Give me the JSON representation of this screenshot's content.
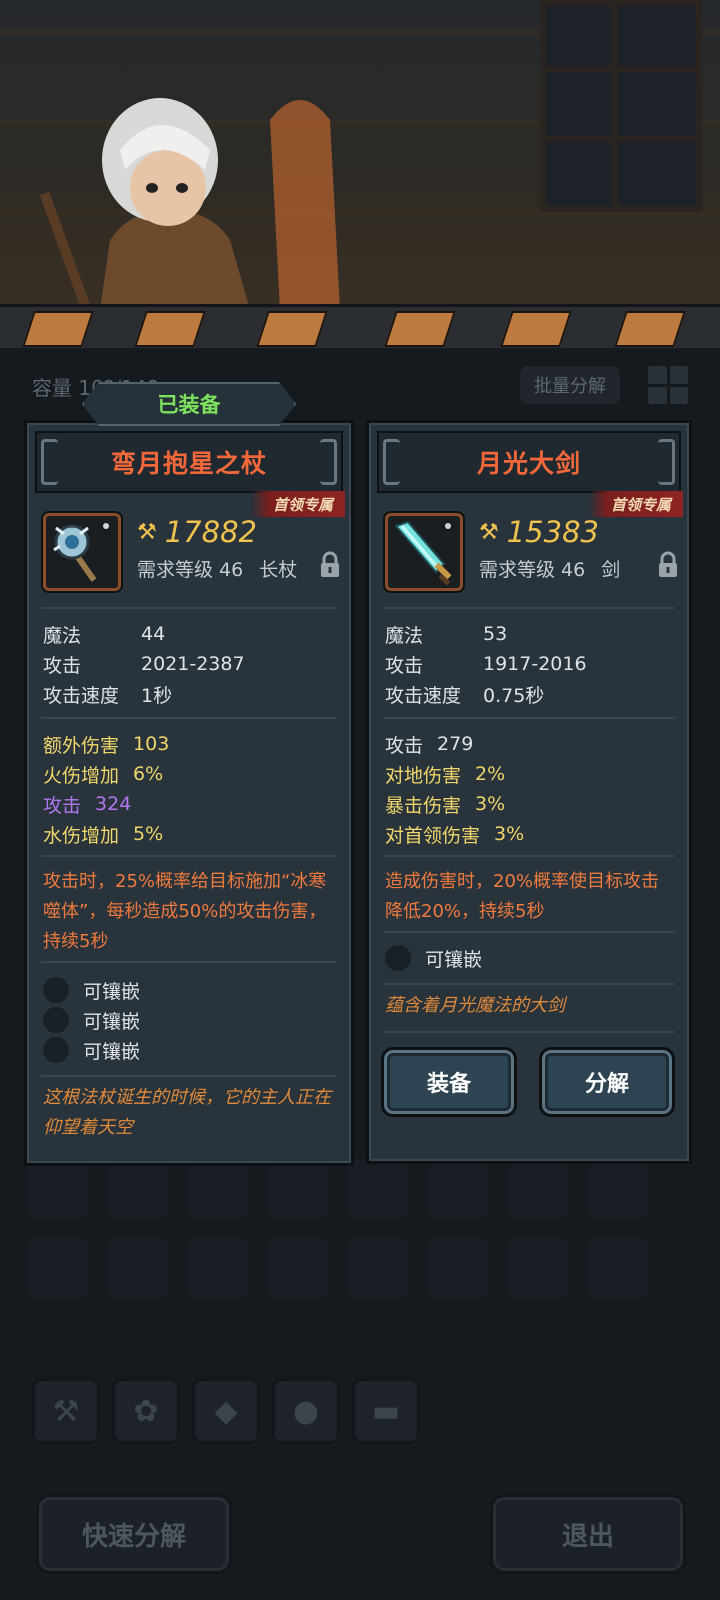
{
  "background": {
    "capacity_label": "容量 10?/140",
    "batch_button": "批量分解",
    "tabs": [
      "hammer-icon",
      "paw-icon",
      "gem-icon",
      "blob-icon",
      "chest-icon"
    ],
    "quick_decompose": "快速分解",
    "exit": "退出"
  },
  "equipped_label": "已装备",
  "left_card": {
    "title": "弯月抱星之杖",
    "tag": "首领专属",
    "power": "17882",
    "req_level": "需求等级 46",
    "type": "长杖",
    "base_stats": [
      {
        "k": "魔法",
        "v": "44"
      },
      {
        "k": "攻击",
        "v": "2021-2387"
      },
      {
        "k": "攻击速度",
        "v": "1秒"
      }
    ],
    "bonus_stats": [
      {
        "k": "额外伤害",
        "v": "103"
      },
      {
        "k": "火伤增加",
        "v": "6%"
      },
      {
        "k": "攻击",
        "v": "324"
      },
      {
        "k": "水伤增加",
        "v": "5%"
      }
    ],
    "effect": "攻击时，25%概率给目标施加“冰寒噬体”，每秒造成50%的攻击伤害，持续5秒",
    "sockets": [
      "可镶嵌",
      "可镶嵌",
      "可镶嵌"
    ],
    "flavor": "这根法杖诞生的时候，它的主人正在仰望着天空"
  },
  "right_card": {
    "title": "月光大剑",
    "tag": "首领专属",
    "power": "15383",
    "req_level": "需求等级 46",
    "type": "剑",
    "base_stats": [
      {
        "k": "魔法",
        "v": "53"
      },
      {
        "k": "攻击",
        "v": "1917-2016"
      },
      {
        "k": "攻击速度",
        "v": "0.75秒"
      }
    ],
    "bonus_stats": [
      {
        "k": "攻击",
        "v": "279"
      },
      {
        "k": "对地伤害",
        "v": "2%"
      },
      {
        "k": "暴击伤害",
        "v": "3%"
      },
      {
        "k": "对首领伤害",
        "v": "3%"
      }
    ],
    "effect": "造成伤害时，20%概率使目标攻击降低20%，持续5秒",
    "sockets": [
      "可镶嵌"
    ],
    "flavor": "蕴含着月光魔法的大剑",
    "equip_button": "装备",
    "decompose_button": "分解"
  },
  "colors": {
    "title_orange": "#f3683a",
    "power_gold": "#f0c24e",
    "bonus_yellow": "#f0d66a",
    "bonus_purple": "#b377f2",
    "effect_orange": "#f07a3e",
    "equipped_green": "#7ee35c"
  }
}
